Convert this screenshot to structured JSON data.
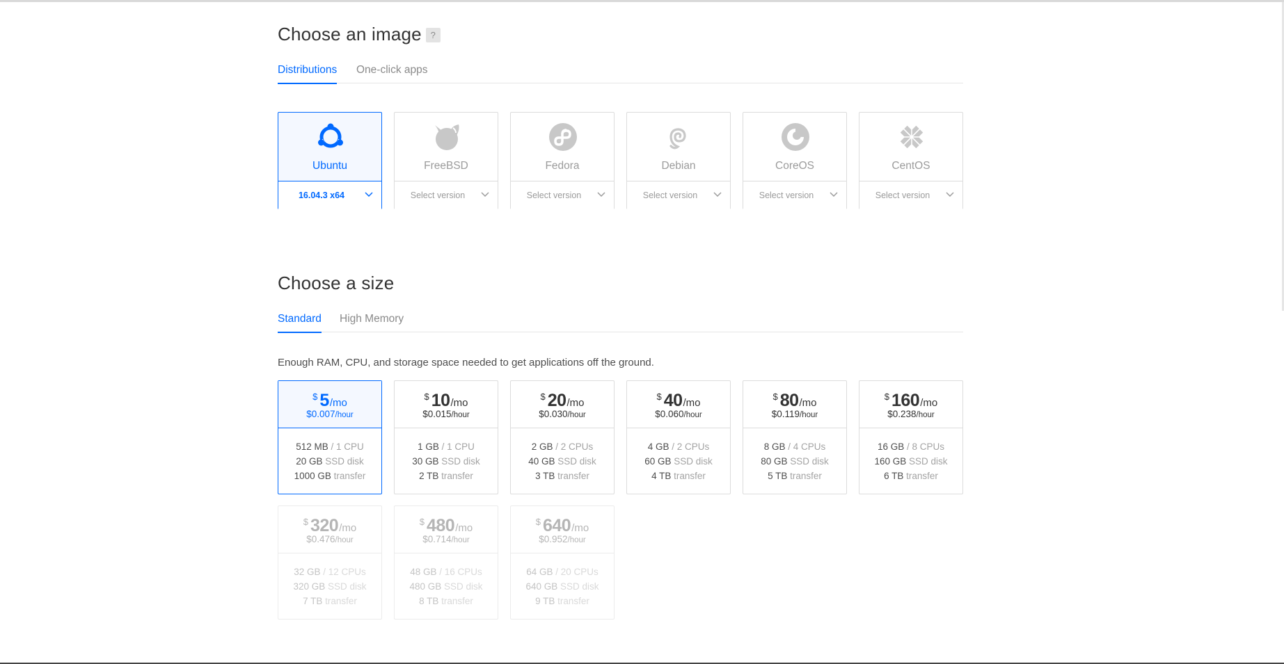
{
  "image_section": {
    "title": "Choose an image",
    "help": "?",
    "tabs": [
      {
        "label": "Distributions",
        "active": true
      },
      {
        "label": "One-click apps",
        "active": false
      }
    ],
    "distributions": [
      {
        "name": "Ubuntu",
        "version": "16.04.3 x64",
        "selected": true,
        "icon": "ubuntu-icon"
      },
      {
        "name": "FreeBSD",
        "version": "Select version",
        "selected": false,
        "icon": "freebsd-icon"
      },
      {
        "name": "Fedora",
        "version": "Select version",
        "selected": false,
        "icon": "fedora-icon"
      },
      {
        "name": "Debian",
        "version": "Select version",
        "selected": false,
        "icon": "debian-icon"
      },
      {
        "name": "CoreOS",
        "version": "Select version",
        "selected": false,
        "icon": "coreos-icon"
      },
      {
        "name": "CentOS",
        "version": "Select version",
        "selected": false,
        "icon": "centos-icon"
      }
    ]
  },
  "size_section": {
    "title": "Choose a size",
    "tabs": [
      {
        "label": "Standard",
        "active": true
      },
      {
        "label": "High Memory",
        "active": false
      }
    ],
    "description": "Enough RAM, CPU, and storage space needed to get applications off the ground.",
    "currency": "$",
    "per_month": "/mo",
    "per_hour": "/hour",
    "plans": [
      {
        "monthly": "5",
        "hourly": "$0.007",
        "ram": "512 MB",
        "cpu": " / 1 CPU",
        "disk": "20 GB",
        "disk_label": " SSD disk",
        "transfer": "1000 GB",
        "transfer_label": " transfer",
        "selected": true,
        "disabled": false
      },
      {
        "monthly": "10",
        "hourly": "$0.015",
        "ram": "1 GB",
        "cpu": " / 1 CPU",
        "disk": "30 GB",
        "disk_label": " SSD disk",
        "transfer": "2 TB",
        "transfer_label": " transfer",
        "selected": false,
        "disabled": false
      },
      {
        "monthly": "20",
        "hourly": "$0.030",
        "ram": "2 GB",
        "cpu": " / 2 CPUs",
        "disk": "40 GB",
        "disk_label": " SSD disk",
        "transfer": "3 TB",
        "transfer_label": " transfer",
        "selected": false,
        "disabled": false
      },
      {
        "monthly": "40",
        "hourly": "$0.060",
        "ram": "4 GB",
        "cpu": " / 2 CPUs",
        "disk": "60 GB",
        "disk_label": " SSD disk",
        "transfer": "4 TB",
        "transfer_label": " transfer",
        "selected": false,
        "disabled": false
      },
      {
        "monthly": "80",
        "hourly": "$0.119",
        "ram": "8 GB",
        "cpu": " / 4 CPUs",
        "disk": "80 GB",
        "disk_label": " SSD disk",
        "transfer": "5 TB",
        "transfer_label": " transfer",
        "selected": false,
        "disabled": false
      },
      {
        "monthly": "160",
        "hourly": "$0.238",
        "ram": "16 GB",
        "cpu": " / 8 CPUs",
        "disk": "160 GB",
        "disk_label": " SSD disk",
        "transfer": "6 TB",
        "transfer_label": " transfer",
        "selected": false,
        "disabled": false
      },
      {
        "monthly": "320",
        "hourly": "$0.476",
        "ram": "32 GB",
        "cpu": " / 12 CPUs",
        "disk": "320 GB",
        "disk_label": " SSD disk",
        "transfer": "7 TB",
        "transfer_label": " transfer",
        "selected": false,
        "disabled": true
      },
      {
        "monthly": "480",
        "hourly": "$0.714",
        "ram": "48 GB",
        "cpu": " / 16 CPUs",
        "disk": "480 GB",
        "disk_label": " SSD disk",
        "transfer": "8 TB",
        "transfer_label": " transfer",
        "selected": false,
        "disabled": true
      },
      {
        "monthly": "640",
        "hourly": "$0.952",
        "ram": "64 GB",
        "cpu": " / 20 CPUs",
        "disk": "640 GB",
        "disk_label": " SSD disk",
        "transfer": "9 TB",
        "transfer_label": " transfer",
        "selected": false,
        "disabled": true
      }
    ]
  },
  "colors": {
    "accent": "#0069ff",
    "selected_bg": "#f4f8ff",
    "border": "#dcdcdc",
    "icon_gray": "#c8c8c8"
  }
}
